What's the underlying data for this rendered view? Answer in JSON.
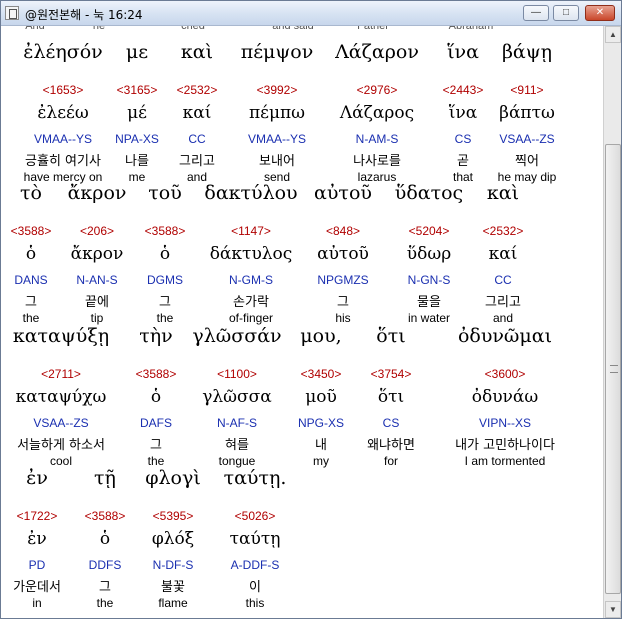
{
  "window": {
    "title": "@원전본해 - 눅 16:24",
    "icon": "document-icon",
    "controls": {
      "minimize": "minimize-icon",
      "maximize": "maximize-icon",
      "close": "close-icon"
    }
  },
  "cut_top_row": [
    "And",
    "he",
    "cried",
    "and said",
    "Father",
    "Abraham"
  ],
  "blocks": [
    {
      "words": [
        {
          "greek": "ἐλέησόν",
          "strong": "<1653>",
          "lemma": "ἐλεέω",
          "parse": "VMAA--YS",
          "korean": "긍휼히 여기사",
          "english": "have mercy on"
        },
        {
          "greek": "με",
          "strong": "<3165>",
          "lemma": "μέ",
          "parse": "NPA-XS",
          "korean": "나를",
          "english": "me"
        },
        {
          "greek": "καὶ",
          "strong": "<2532>",
          "lemma": "καί",
          "parse": "CC",
          "korean": "그리고",
          "english": "and"
        },
        {
          "greek": "πέμψον",
          "strong": "<3992>",
          "lemma": "πέμπω",
          "parse": "VMAA--YS",
          "korean": "보내어",
          "english": "send"
        },
        {
          "greek": "Λάζαρον",
          "strong": "<2976>",
          "lemma": "Λάζαρος",
          "parse": "N-AM-S",
          "korean": "나사로를",
          "english": "lazarus"
        },
        {
          "greek": "ἵνα",
          "strong": "<2443>",
          "lemma": "ἵνα",
          "parse": "CS",
          "korean": "곧",
          "english": "that"
        },
        {
          "greek": "βάψῃ",
          "strong": "<911>",
          "lemma": "βάπτω",
          "parse": "VSAA--ZS",
          "korean": "찍어",
          "english": "he may dip"
        }
      ]
    },
    {
      "words": [
        {
          "greek": "τὸ",
          "strong": "<3588>",
          "lemma": "ὁ",
          "parse": "DANS",
          "korean": "그",
          "english": "the"
        },
        {
          "greek": "ἄκρον",
          "strong": "<206>",
          "lemma": "ἄκρον",
          "parse": "N-AN-S",
          "korean": "끝에",
          "english": "tip"
        },
        {
          "greek": "τοῦ",
          "strong": "<3588>",
          "lemma": "ὁ",
          "parse": "DGMS",
          "korean": "그",
          "english": "the"
        },
        {
          "greek": "δακτύλου",
          "strong": "<1147>",
          "lemma": "δάκτυλος",
          "parse": "N-GM-S",
          "korean": "손가락",
          "english": "of-finger"
        },
        {
          "greek": "αὐτοῦ",
          "strong": "<848>",
          "lemma": "αὐτοῦ",
          "parse": "NPGMZS",
          "korean": "그",
          "english": "his"
        },
        {
          "greek": "ὕδατος",
          "strong": "<5204>",
          "lemma": "ὕδωρ",
          "parse": "N-GN-S",
          "korean": "물을",
          "english": "in water"
        },
        {
          "greek": "καὶ",
          "strong": "<2532>",
          "lemma": "καί",
          "parse": "CC",
          "korean": "그리고",
          "english": "and"
        }
      ]
    },
    {
      "words": [
        {
          "greek": "καταψύξῃ",
          "strong": "<2711>",
          "lemma": "καταψύχω",
          "parse": "VSAA--ZS",
          "korean": "서늘하게 하소서",
          "english": "cool"
        },
        {
          "greek": "τὴν",
          "strong": "<3588>",
          "lemma": "ὁ",
          "parse": "DAFS",
          "korean": "그",
          "english": "the"
        },
        {
          "greek": "γλῶσσάν",
          "strong": "<1100>",
          "lemma": "γλῶσσα",
          "parse": "N-AF-S",
          "korean": "혀를",
          "english": "tongue"
        },
        {
          "greek": "μου,",
          "strong": "<3450>",
          "lemma": "μοῦ",
          "parse": "NPG-XS",
          "korean": "내",
          "english": "my"
        },
        {
          "greek": "ὅτι",
          "strong": "<3754>",
          "lemma": "ὅτι",
          "parse": "CS",
          "korean": "왜냐하면",
          "english": "for"
        },
        {
          "greek": "ὀδυνῶμαι",
          "strong": "<3600>",
          "lemma": "ὀδυνάω",
          "parse": "VIPN--XS",
          "korean": "내가 고민하나이다",
          "english": "I am tormented"
        }
      ]
    },
    {
      "words": [
        {
          "greek": "ἐν",
          "strong": "<1722>",
          "lemma": "ἐν",
          "parse": "PD",
          "korean": "가운데서",
          "english": "in"
        },
        {
          "greek": "τῇ",
          "strong": "<3588>",
          "lemma": "ὁ",
          "parse": "DDFS",
          "korean": "그",
          "english": "the"
        },
        {
          "greek": "φλογὶ",
          "strong": "<5395>",
          "lemma": "φλόξ",
          "parse": "N-DF-S",
          "korean": "불꽃",
          "english": "flame"
        },
        {
          "greek": "ταύτῃ.",
          "strong": "<5026>",
          "lemma": "ταύτῃ",
          "parse": "A-DDF-S",
          "korean": "이",
          "english": "this"
        }
      ]
    }
  ]
}
